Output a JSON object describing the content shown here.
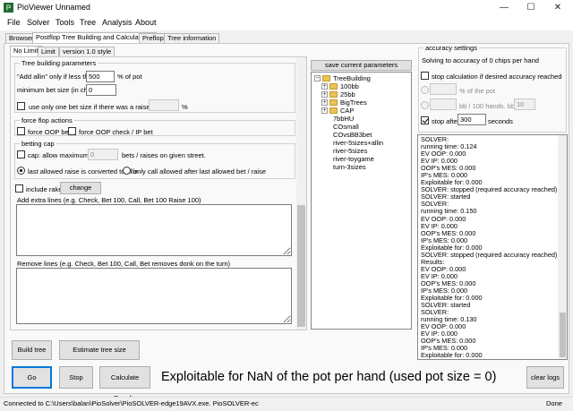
{
  "window": {
    "title": "PioViewer Unnamed",
    "min_glyph": "—",
    "max_glyph": "☐",
    "close_glyph": "✕"
  },
  "menu": [
    "File",
    "Solver",
    "Tools",
    "Tree",
    "Analysis",
    "About"
  ],
  "main_tabs": [
    "Browser",
    "Postflop Tree Building and Calculations",
    "Preflop",
    "Tree information"
  ],
  "sub_tabs": [
    "No Limit",
    "Limit",
    "version 1.0 style"
  ],
  "tree_params": {
    "group_title": "Tree building parameters",
    "allin_label": "\"Add allin\" only if less than",
    "allin_value": "500",
    "allin_suffix": "% of pot",
    "min_bet_label": "minimum bet size (in chips):",
    "min_bet_value": "0",
    "one_bet_label": "use only one bet size if there was a raise before",
    "one_bet_suffix": "%"
  },
  "force_flop": {
    "group_title": "force flop actions",
    "oop_bet": "force OOP bet",
    "oop_check": "force OOP check / IP bet"
  },
  "betting_cap": {
    "group_title": "betting cap",
    "cap_label": "cap: allow maximum of",
    "cap_value": "0",
    "cap_suffix": "bets / raises on given street.",
    "radio_allin": "last allowed raise is converted to allin",
    "radio_call": "only call allowed after last allowed bet / raise"
  },
  "rake": {
    "label": "include rake",
    "change_button": "change"
  },
  "extra_lines_label": "Add extra lines (e.g. Check, Bet 100, Call, Bet 100 Raise 100)",
  "remove_lines_label": "Remove lines (e.g. Check, Bet 100, Call, Bet removes donk on the turn)",
  "buttons": {
    "save_params": "save current parameters",
    "build_tree": "Build tree",
    "estimate": "Estimate tree size",
    "go": "Go",
    "stop": "Stop",
    "calc_results": "Calculate Results",
    "clear_logs": "clear logs"
  },
  "tree": {
    "root": "TreeBuilding",
    "expander_plus": "+",
    "expander_minus": "−",
    "folders": [
      "100bb",
      "25bb",
      "BigTrees",
      "CAP"
    ],
    "files": [
      "7bbHU",
      "COsmall",
      "COvsBB3bet",
      "river-5sizes+allin",
      "river-5sizes",
      "river-toygame",
      "turn-3sizes"
    ]
  },
  "accuracy": {
    "group_title": "accuracy settings",
    "summary": "Solving to accuracy of 0 chips per hand",
    "stop_calc_label": "stop calculation if desired accuracy reached",
    "pct_pot_label": "% of the pot",
    "bb100_label": "bb / 100 hands. bb =",
    "bb_value": "10",
    "stop_after_label": "stop after",
    "stop_after_value": "300",
    "seconds_label": "seconds"
  },
  "log_lines": [
    "SOLVER:",
    "running time: 0.124",
    "EV OOP: 0.000",
    "EV IP: 0.000",
    "OOP's MES: 0.000",
    "IP's MES: 0.000",
    "Exploitable for: 0.000",
    "SOLVER: stopped (required accuracy reached)",
    "SOLVER: started",
    "SOLVER:",
    "running time: 0.150",
    "EV OOP: 0.000",
    "EV IP: 0.000",
    "OOP's MES: 0.000",
    "IP's MES: 0.000",
    "Exploitable for: 0.000",
    "SOLVER: stopped (required accuracy reached)",
    "Results:",
    "EV OOP: 0.000",
    "EV IP: 0.000",
    "OOP's MES: 0.000",
    "IP's MES: 0.000",
    "Exploitable for: 0.000",
    "SOLVER: started",
    "SOLVER:",
    "running time: 0.130",
    "EV OOP: 0.000",
    "EV IP: 0.000",
    "OOP's MES: 0.000",
    "IP's MES: 0.000",
    "Exploitable for: 0.000",
    "SOLVER: stopped (required accuracy reached)"
  ],
  "exploitable_message": "Exploitable for NaN of the pot per hand (used pot size = 0)",
  "status": {
    "connection": "Connected to C:\\Users\\balan\\PioSolver\\PioSOLVER-edge19AVX.exe. PioSOLVER-ec",
    "state": "Done"
  },
  "colors": {
    "accent": "#0078d7",
    "folder": "#e8c45a"
  }
}
